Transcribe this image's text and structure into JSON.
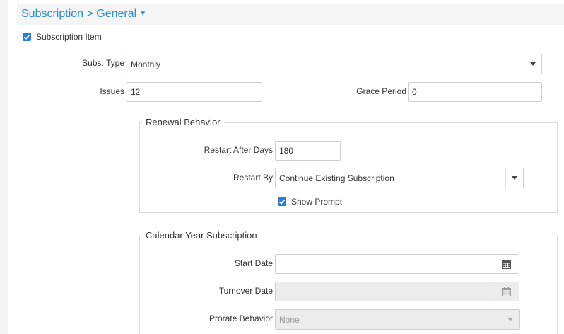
{
  "header": {
    "title": "Subscription > General"
  },
  "subscription_item": {
    "label": "Subscription Item",
    "checked": true
  },
  "subs_type": {
    "label": "Subs. Type",
    "value": "Monthly"
  },
  "issues": {
    "label": "Issues",
    "value": "12"
  },
  "grace_period": {
    "label": "Grace Period",
    "value": "0"
  },
  "renewal": {
    "legend": "Renewal Behavior",
    "restart_after_days": {
      "label": "Restart After Days",
      "value": "180"
    },
    "restart_by": {
      "label": "Restart By",
      "value": "Continue Existing Subscription"
    },
    "show_prompt": {
      "label": "Show Prompt",
      "checked": true
    }
  },
  "calendar": {
    "legend": "Calendar Year Subscription",
    "start_date": {
      "label": "Start Date",
      "value": ""
    },
    "turnover_date": {
      "label": "Turnover Date",
      "value": ""
    },
    "prorate_behavior": {
      "label": "Prorate Behavior",
      "value": "None"
    }
  },
  "icons": {
    "caret": "caret-down-icon",
    "checkbox": "check-icon",
    "calendar": "calendar-icon"
  },
  "colors": {
    "accent": "#2a8fd0",
    "checkbox": "#2a7fd4"
  }
}
